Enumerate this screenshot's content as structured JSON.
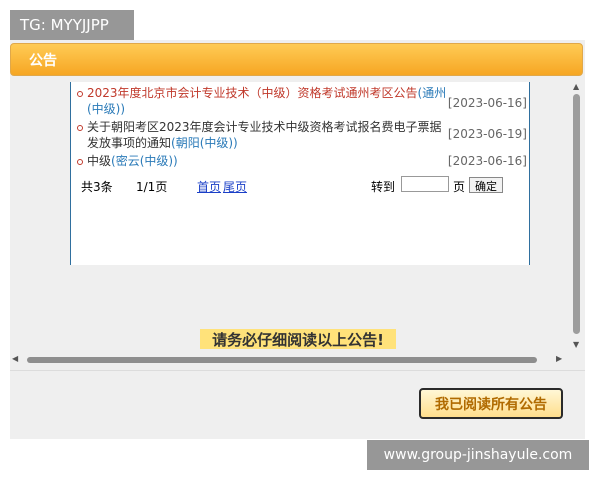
{
  "watermark_top": "TG: MYYJJPP",
  "watermark_bottom": "www.group-jinshayule.com",
  "dialog": {
    "title": "公告",
    "notices": [
      {
        "text": "2023年度北京市会计专业技术（中级）资格考试通州考区公告",
        "tag": "(通州(中级))",
        "date": "[2023-06-16]"
      },
      {
        "text": "关于朝阳考区2023年度会计专业技术中级资格考试报名费电子票据发放事项的通知",
        "tag": "(朝阳(中级))",
        "date": "[2023-06-19]"
      },
      {
        "text": "中级",
        "tag": "(密云(中级))",
        "date": "[2023-06-16]"
      }
    ],
    "pager": {
      "total": "共3条",
      "page": "1/1页",
      "first": "首页",
      "last": "尾页",
      "goto": "转到",
      "page_unit": "页",
      "confirm": "确定"
    },
    "warning": "请务必仔细阅读以上公告!",
    "confirm_all": "我已阅读所有公告"
  },
  "icons": {
    "scroll_up": "arrow-up-icon",
    "scroll_down": "arrow-down-icon",
    "scroll_left": "arrow-left-icon",
    "scroll_right": "arrow-right-icon"
  },
  "colors": {
    "header_orange": "#f6a623",
    "notice_red": "#c0392b",
    "link_blue": "#2a7ab8",
    "warning_yellow": "#ffe27a"
  }
}
